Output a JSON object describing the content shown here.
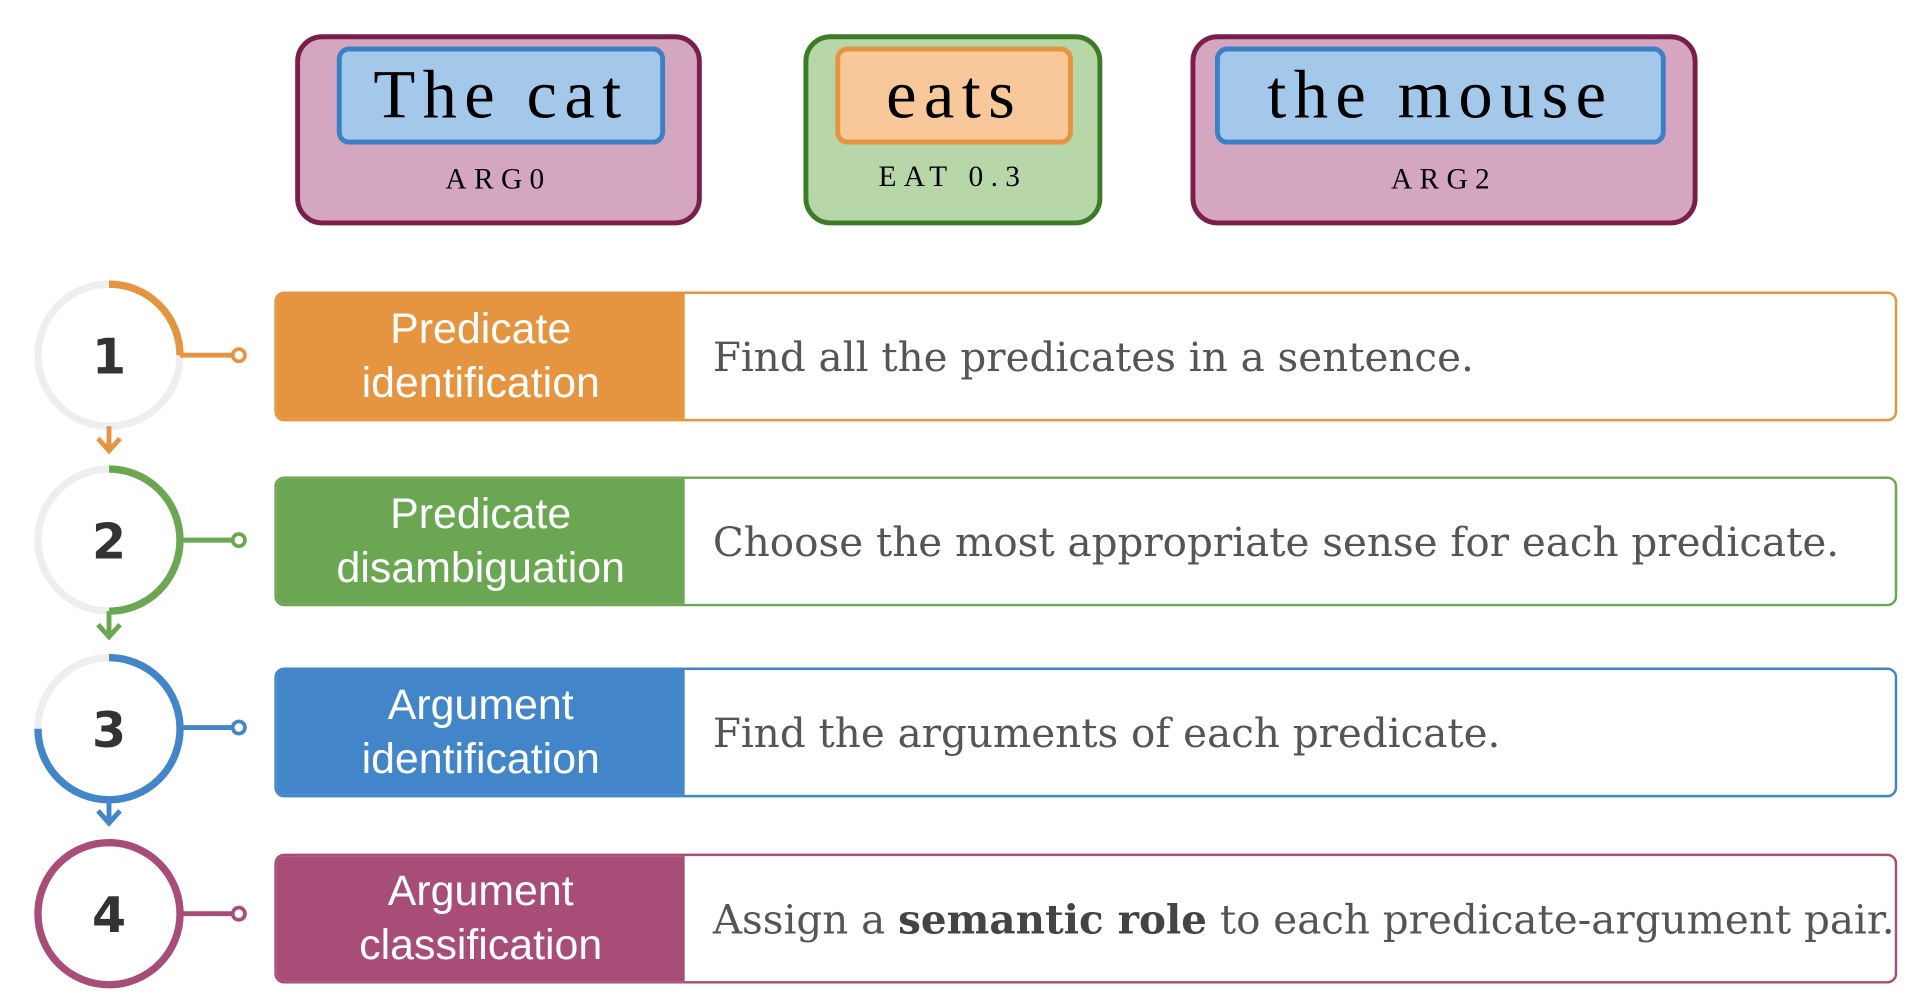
{
  "example": {
    "arg0": {
      "text": "The cat",
      "tag": "ARG0"
    },
    "predicate": {
      "text": "eats",
      "tag": "EAT 0.3"
    },
    "arg2": {
      "text": "the mouse",
      "tag": "ARG2"
    }
  },
  "steps": [
    {
      "number": "1",
      "label": "Predicate\nidentification",
      "description": "Find all the predicates in a sentence.",
      "color": "#E59440"
    },
    {
      "number": "2",
      "label": "Predicate\ndisambiguation",
      "description": "Choose the most appropriate sense for each predicate.",
      "color": "#6BA752"
    },
    {
      "number": "3",
      "label": "Argument\nidentification",
      "description": "Find the arguments of each predicate.",
      "color": "#4285C8"
    },
    {
      "number": "4",
      "label": "Argument\nclassification",
      "description_before": "Assign a ",
      "description_bold": "semantic role",
      "description_after": " to each predicate-argument pair.",
      "color": "#A74D77"
    }
  ],
  "colors": {
    "arg_box_fill": "#D4A6C0",
    "arg_box_border": "#7A1E4C",
    "pred_box_fill": "#B7D7A8",
    "pred_box_border": "#3E7B27",
    "word_fill": "#A4C8EA",
    "word_border": "#3D7FC5",
    "pred_word_fill": "#F9C89A",
    "pred_word_border": "#E59440",
    "ring_gray": "#EEEEEE"
  }
}
